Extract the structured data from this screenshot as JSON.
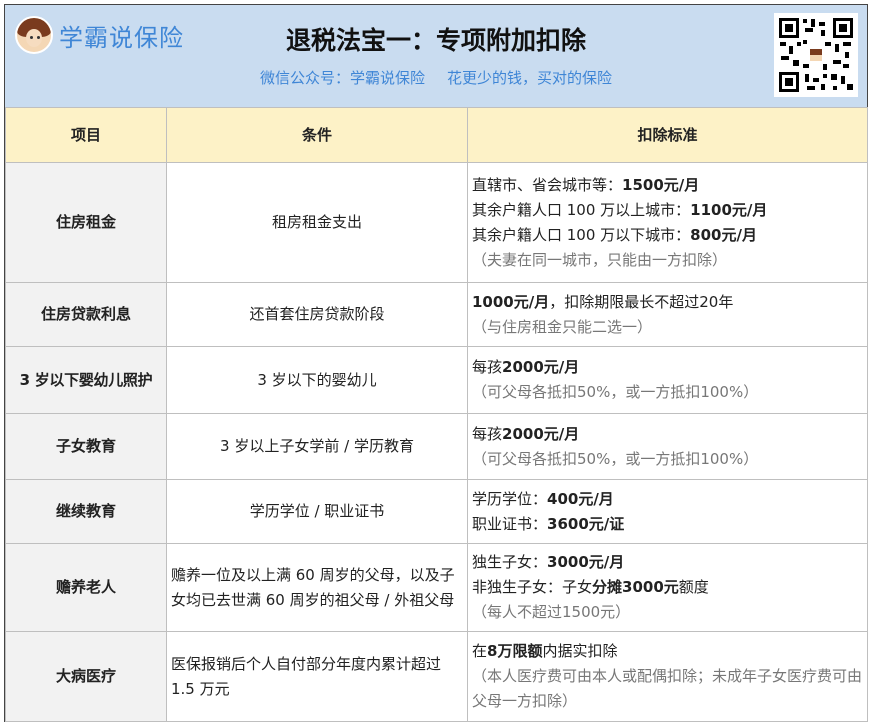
{
  "header": {
    "brand": "学霸说保险",
    "title": "退税法宝一：专项附加扣除",
    "wechat": "微信公众号：学霸说保险",
    "slogan": "花更少的钱，买对的保险"
  },
  "columns": [
    "项目",
    "条件",
    "扣除标准"
  ],
  "rows": [
    {
      "item": "住房租金",
      "condition": "租房租金支出",
      "lines": [
        {
          "text": "直辖市、省会城市等：",
          "bold": "1500元/月"
        },
        {
          "text": "其余户籍人口 100 万以上城市：",
          "bold": "1100元/月"
        },
        {
          "text": "其余户籍人口 100 万以下城市：",
          "bold": "800元/月"
        }
      ],
      "note": "（夫妻在同一城市，只能由一方扣除）"
    },
    {
      "item": "住房贷款利息",
      "condition": "还首套住房贷款阶段",
      "lines": [
        {
          "bold": "1000元/月",
          "text": "，扣除期限最长不超过20年"
        }
      ],
      "note": "（与住房租金只能二选一）"
    },
    {
      "item": "3 岁以下婴幼儿照护",
      "condition": "3 岁以下的婴幼儿",
      "lines": [
        {
          "text": "每孩",
          "bold": "2000元/月"
        }
      ],
      "note": "（可父母各抵扣50%，或一方抵扣100%）"
    },
    {
      "item": "子女教育",
      "condition": "3 岁以上子女学前 / 学历教育",
      "lines": [
        {
          "text": "每孩",
          "bold": "2000元/月"
        }
      ],
      "note": "（可父母各抵扣50%，或一方抵扣100%）"
    },
    {
      "item": "继续教育",
      "condition": "学历学位 / 职业证书",
      "lines": [
        {
          "text": "学历学位：",
          "bold": "400元/月"
        },
        {
          "text": "职业证书：",
          "bold": "3600元/证"
        }
      ],
      "note": ""
    },
    {
      "item": "赡养老人",
      "condition": "赡养一位及以上满 60 周岁的父母，以及子女均已去世满 60 周岁的祖父母 / 外祖父母",
      "lines": [
        {
          "text": "独生子女：",
          "bold": "3000元/月"
        },
        {
          "text": "非独生子女：子女",
          "bold": "分摊3000元",
          "after": "额度"
        }
      ],
      "note": "（每人不超过1500元）"
    },
    {
      "item": "大病医疗",
      "condition": "医保报销后个人自付部分年度内累计超过 1.5 万元",
      "lines": [
        {
          "text": "在",
          "bold": "8万限额",
          "after": "内据实扣除"
        }
      ],
      "note": "（本人医疗费可由本人或配偶扣除；未成年子女医疗费可由父母一方扣除）"
    }
  ]
}
